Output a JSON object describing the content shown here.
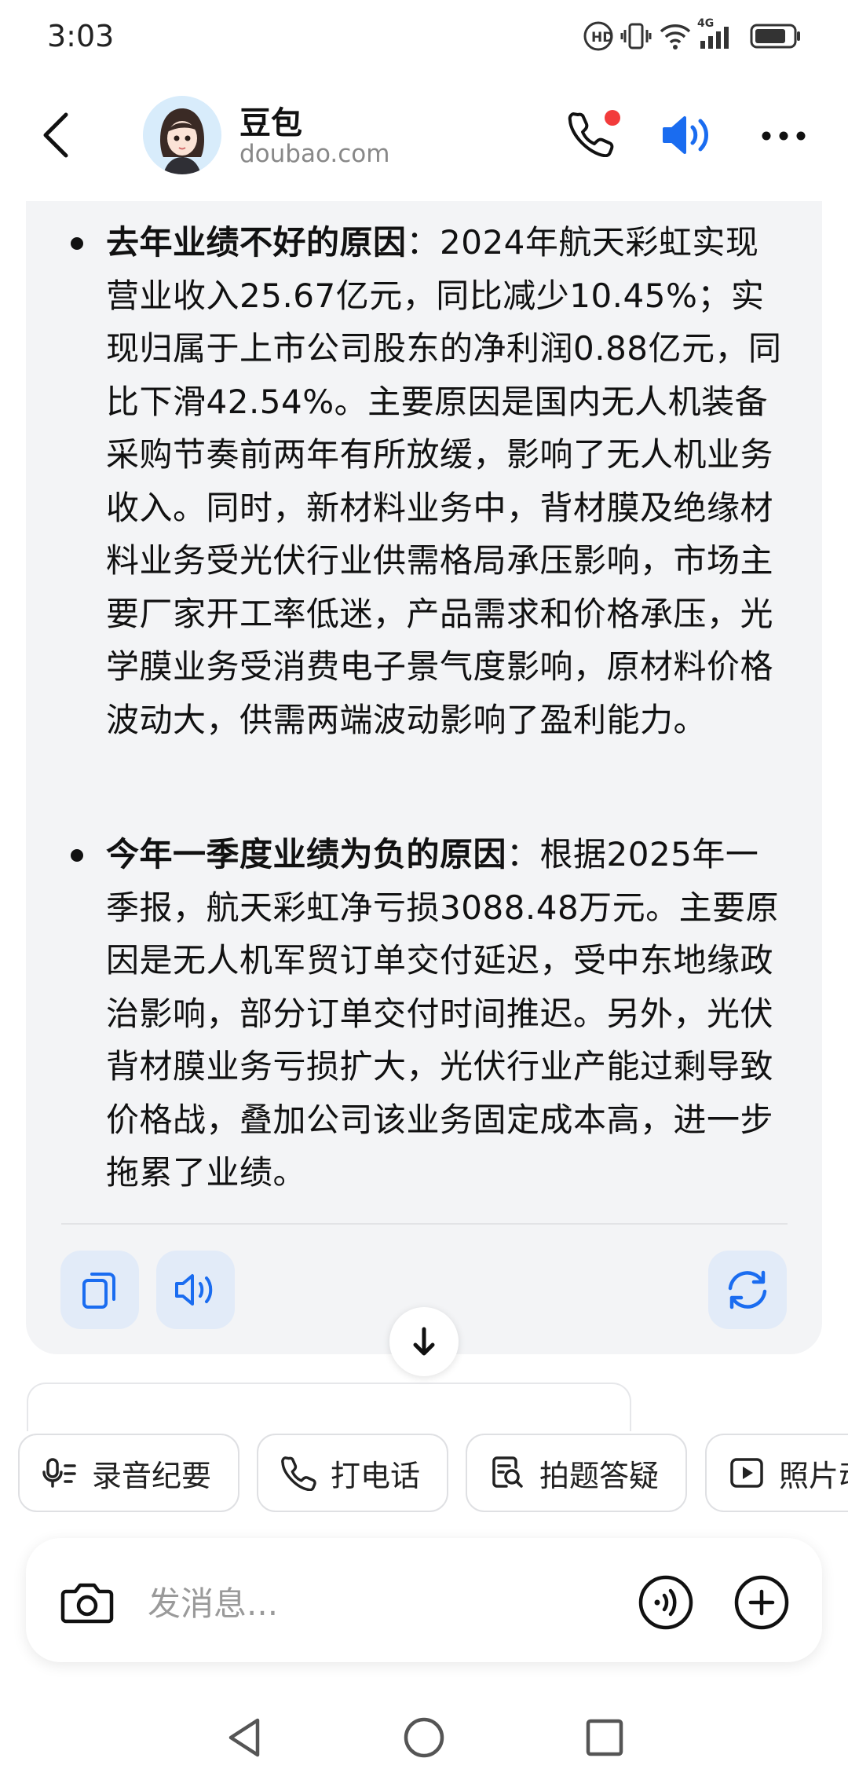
{
  "status_bar": {
    "time": "3:03",
    "icons": [
      "hd-call-icon",
      "vibrate-icon",
      "wifi-icon",
      "signal-4g-icon",
      "battery-icon"
    ],
    "network": "4G"
  },
  "header": {
    "title": "豆包",
    "subtitle": "doubao.com",
    "back_icon": "back-arrow-icon",
    "phone_icon": "phone-icon",
    "speaker_icon": "speaker-icon",
    "more_icon": "more-icon"
  },
  "message": {
    "items": [
      {
        "heading": "去年业绩不好的原因",
        "text": "：2024年航天彩虹实现营业收入25.67亿元，同比减少10.45%；实现归属于上市公司股东的净利润0.88亿元，同比下滑42.54%。主要原因是国内无人机装备采购节奏前两年有所放缓，影响了无人机业务收入。同时，新材料业务中，背材膜及绝缘材料业务受光伏行业供需格局承压影响，市场主要厂家开工率低迷，产品需求和价格承压，光学膜业务受消费电子景气度影响，原材料价格波动大，供需两端波动影响了盈利能力。"
      },
      {
        "heading": "今年一季度业绩为负的原因",
        "text": "：根据2025年一季报，航天彩虹净亏损3088.48万元。主要原因是无人机军贸订单交付延迟，受中东地缘政治影响，部分订单交付时间推迟。另外，光伏背材膜业务亏损扩大，光伏行业产能过剩导致价格战，叠加公司该业务固定成本高，进一步拖累了业绩。"
      }
    ],
    "actions": [
      "copy-icon",
      "read-aloud-icon",
      "regenerate-icon"
    ]
  },
  "chips": [
    {
      "icon": "mic-notes-icon",
      "label": "录音纪要"
    },
    {
      "icon": "phone-icon",
      "label": "打电话"
    },
    {
      "icon": "search-doc-icon",
      "label": "拍题答疑"
    },
    {
      "icon": "play-icon",
      "label": "照片动"
    }
  ],
  "input": {
    "placeholder": "发消息..."
  },
  "colors": {
    "accent": "#1a6cf0",
    "card_bg": "#f3f4f6",
    "action_bg": "#e2ebf8",
    "badge_red": "#f23b3b"
  }
}
